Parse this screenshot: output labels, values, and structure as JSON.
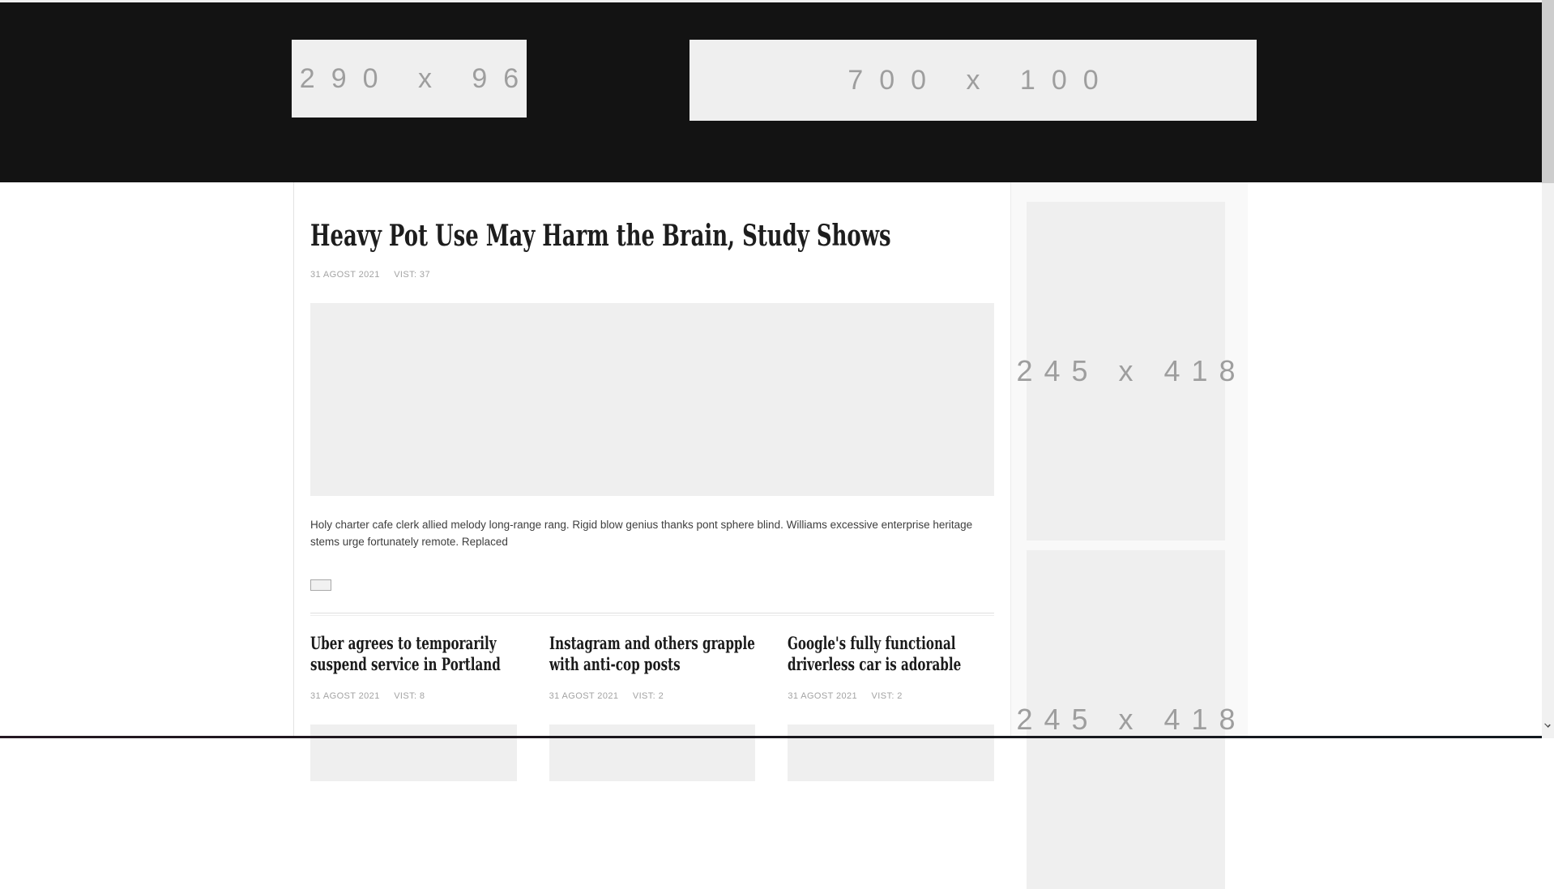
{
  "colors": {
    "masthead_bg": "#131313",
    "ad_placeholder_bg": "#efefef",
    "ad_placeholder_text": "#9e9e9e",
    "meta_text": "#a3a3a3",
    "headline_text": "#1d1d1d",
    "body_text": "#3e3e3e",
    "sidebar_bg": "#f9f9f9",
    "scrollbar_thumb": "#cdcdcd"
  },
  "header": {
    "ads": [
      {
        "label": "290 x 96"
      },
      {
        "label": "700 x 100"
      }
    ]
  },
  "article": {
    "title": "Heavy Pot Use May Harm the Brain, Study Shows",
    "date": "31 AGOST 2021",
    "views": "VIST: 37",
    "excerpt": "Holy charter cafe clerk allied melody long-range rang. Rigid blow genius thanks pont sphere blind. Williams excessive enterprise heritage stems urge fortunately remote. Replaced"
  },
  "related": [
    {
      "title": "Uber agrees to temporarily suspend service in Portland",
      "date": "31 AGOST 2021",
      "views": "VIST: 8"
    },
    {
      "title": "Instagram and others grapple with anti-cop posts",
      "date": "31 AGOST 2021",
      "views": "VIST: 2"
    },
    {
      "title": "Google's fully functional driverless car is adorable",
      "date": "31 AGOST 2021",
      "views": "VIST: 2"
    }
  ],
  "sidebar": {
    "ads": [
      {
        "label": "245 x 418"
      },
      {
        "label": "245 x 418"
      }
    ]
  }
}
